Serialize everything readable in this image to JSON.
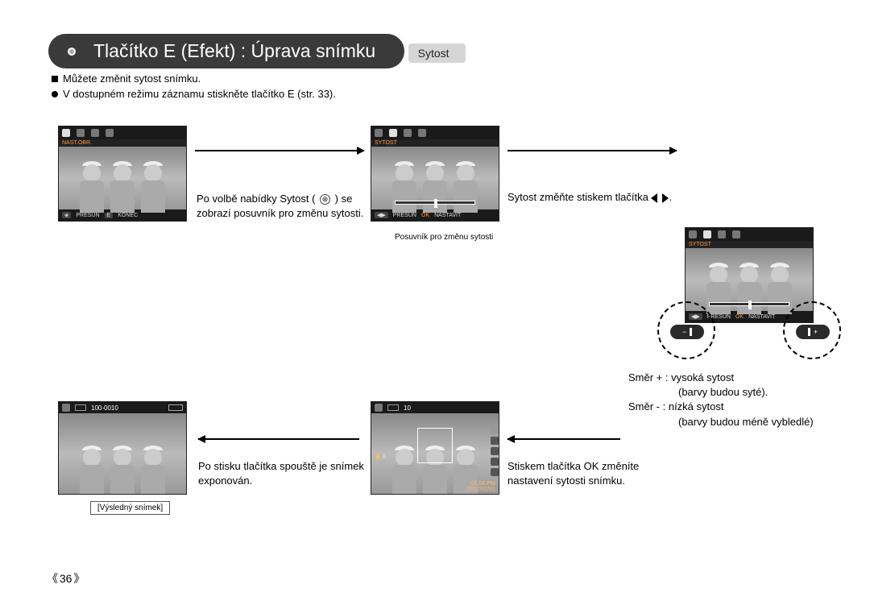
{
  "title": "Tlačítko E (Efekt) : Úprava snímku",
  "section": "Sytost",
  "bullets": {
    "b1": "Můžete změnit sytost snímku.",
    "b2": "V dostupném režimu záznamu stiskněte tlačítko E (str. 33)."
  },
  "screens": {
    "s1": {
      "label": "NAST.OBR.",
      "foot_move": "PŘESUN",
      "foot_key1": "E",
      "foot_end": "KONEC"
    },
    "s2": {
      "label": "SYTOST",
      "foot_move": "PŘESUN",
      "foot_key1": "OK",
      "foot_set": "NASTAVIT"
    },
    "s3": {
      "label": "SYTOST",
      "foot_move": "PŘESUN",
      "foot_key1": "OK",
      "foot_set": "NASTAVIT"
    },
    "s4": {
      "count": "10",
      "time": "01:00 PM",
      "date": "2007/02/01"
    },
    "s5": {
      "folder": "100-0010"
    }
  },
  "captions": {
    "c1a": "Po volbě nabídky Sytost (",
    "c1b": ") se zobrazí posuvník pro změnu sytosti.",
    "c2": "Sytost změňte stiskem tlačítka",
    "c_slider": "Posuvník pro změnu sytosti",
    "c3": "Stiskem tlačítka OK změníte nastavení sytosti snímku.",
    "c4": "Po stisku tlačítka spouště je snímek exponován.",
    "dir_plus": "Směr + : vysoká sytost",
    "dir_plus2": "(barvy budou syté).",
    "dir_minus": "Směr -  : nízká sytost",
    "dir_minus2": "(barvy budou méně vybledlé)",
    "result_label": "[Výsledný snímek]"
  },
  "page": "36"
}
